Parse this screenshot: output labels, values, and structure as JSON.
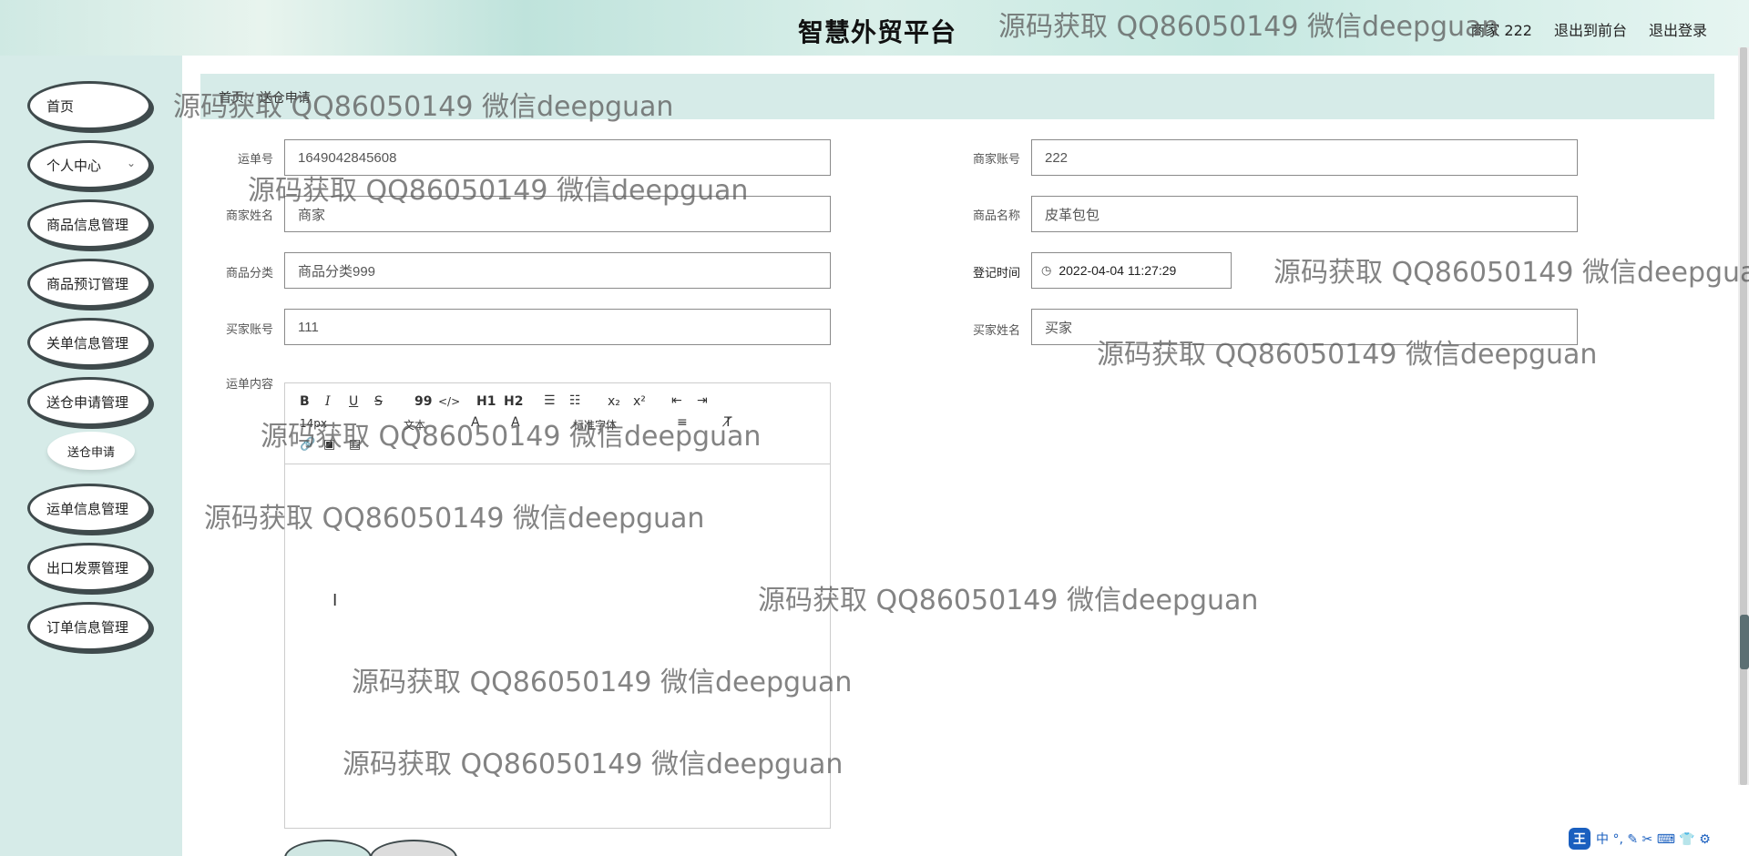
{
  "header": {
    "title": "智慧外贸平台",
    "user_label": "商家 222",
    "to_front_label": "退出到前台",
    "logout_label": "退出登录"
  },
  "sidebar": {
    "items": [
      {
        "label": "首页"
      },
      {
        "label": "个人中心"
      },
      {
        "label": "商品信息管理"
      },
      {
        "label": "商品预订管理"
      },
      {
        "label": "关单信息管理"
      },
      {
        "label": "送仓申请管理"
      },
      {
        "label": "运单信息管理"
      },
      {
        "label": "出口发票管理"
      },
      {
        "label": "订单信息管理"
      }
    ],
    "sub_item": "送仓申请"
  },
  "breadcrumb": {
    "home": "首页",
    "separator": "/",
    "current": "送仓申请"
  },
  "form": {
    "waybill_no": {
      "label": "运单号",
      "value": "1649042845608"
    },
    "merchant_account": {
      "label": "商家账号",
      "value": "222"
    },
    "merchant_name": {
      "label": "商家姓名",
      "value": "商家"
    },
    "product_name": {
      "label": "商品名称",
      "value": "皮革包包"
    },
    "product_category": {
      "label": "商品分类",
      "value": "商品分类999"
    },
    "register_time": {
      "label": "登记时间",
      "value": "2022-04-04 11:27:29"
    },
    "buyer_account": {
      "label": "买家账号",
      "value": "111"
    },
    "buyer_name": {
      "label": "买家姓名",
      "value": "买家"
    },
    "content": {
      "label": "运单内容"
    }
  },
  "editor_toolbar": {
    "bold": "B",
    "italic": "I",
    "underline": "U",
    "strike": "S",
    "quote": "99",
    "code": "</>",
    "h1": "H1",
    "h2": "H2",
    "sub": "x₂",
    "sup": "x²",
    "size_select": "14px",
    "text_select": "文本",
    "font_select": "标准字体"
  },
  "ime": {
    "chars": "中 °, ✎ ✂ ⌨ 👕 ⚙",
    "logo": "王"
  },
  "watermark_text": "源码获取 QQ86050149 微信deepguan"
}
